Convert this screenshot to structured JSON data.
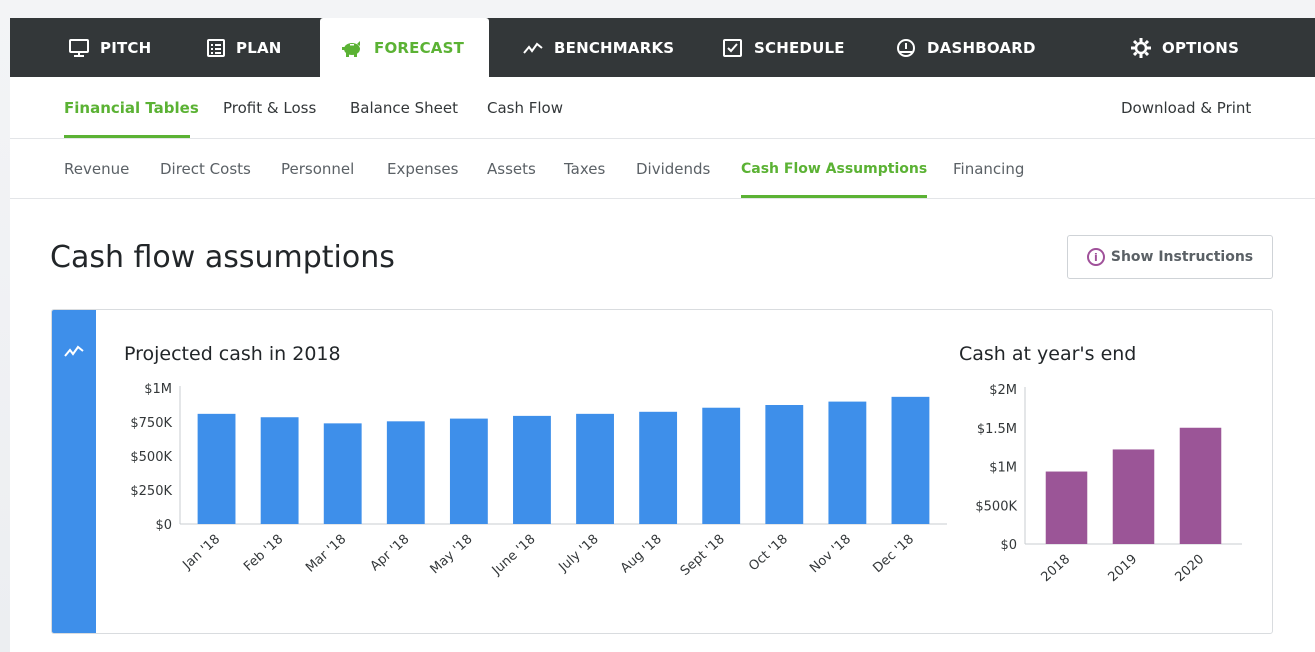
{
  "topnav": {
    "tabs": [
      {
        "label": "PITCH",
        "icon": "monitor-icon"
      },
      {
        "label": "PLAN",
        "icon": "document-list-icon"
      },
      {
        "label": "FORECAST",
        "icon": "piggy-bank-icon",
        "active": true
      },
      {
        "label": "BENCHMARKS",
        "icon": "trend-line-icon"
      },
      {
        "label": "SCHEDULE",
        "icon": "checkbox-icon"
      },
      {
        "label": "DASHBOARD",
        "icon": "gauge-icon"
      },
      {
        "label": "OPTIONS",
        "icon": "gear-icon"
      }
    ]
  },
  "subnav": {
    "items": [
      "Financial Tables",
      "Profit & Loss",
      "Balance Sheet",
      "Cash Flow"
    ],
    "active": "Financial Tables",
    "download_label": "Download & Print"
  },
  "tertnav": {
    "items": [
      "Revenue",
      "Direct Costs",
      "Personnel",
      "Expenses",
      "Assets",
      "Taxes",
      "Dividends",
      "Cash Flow Assumptions",
      "Financing"
    ],
    "active": "Cash Flow Assumptions"
  },
  "page": {
    "title": "Cash flow assumptions",
    "instructions_label": "Show Instructions"
  },
  "colors": {
    "nav_bg": "#333739",
    "accent_green": "#5bb234",
    "bar_blue": "#3e8fea",
    "bar_purple": "#9b5597"
  },
  "chart_data": [
    {
      "type": "bar",
      "title": "Projected cash in 2018",
      "categories": [
        "Jan '18",
        "Feb '18",
        "Mar '18",
        "Apr '18",
        "May '18",
        "June '18",
        "July '18",
        "Aug '18",
        "Sept '18",
        "Oct '18",
        "Nov '18",
        "Dec '18"
      ],
      "values": [
        810000,
        785000,
        740000,
        755000,
        775000,
        795000,
        810000,
        825000,
        855000,
        875000,
        900000,
        935000
      ],
      "ylim": [
        0,
        1000000
      ],
      "yticks": [
        0,
        250000,
        500000,
        750000,
        1000000
      ],
      "ytick_labels": [
        "$0",
        "$250K",
        "$500K",
        "$750K",
        "$1M"
      ],
      "grid": false,
      "color": "#3e8fea"
    },
    {
      "type": "bar",
      "title": "Cash at year's end",
      "categories": [
        "2018",
        "2019",
        "2020"
      ],
      "values": [
        935000,
        1220000,
        1500000
      ],
      "ylim": [
        0,
        2000000
      ],
      "yticks": [
        0,
        500000,
        1000000,
        1500000,
        2000000
      ],
      "ytick_labels": [
        "$0",
        "$500K",
        "$1M",
        "$1.5M",
        "$2M"
      ],
      "grid": false,
      "color": "#9b5597"
    }
  ]
}
